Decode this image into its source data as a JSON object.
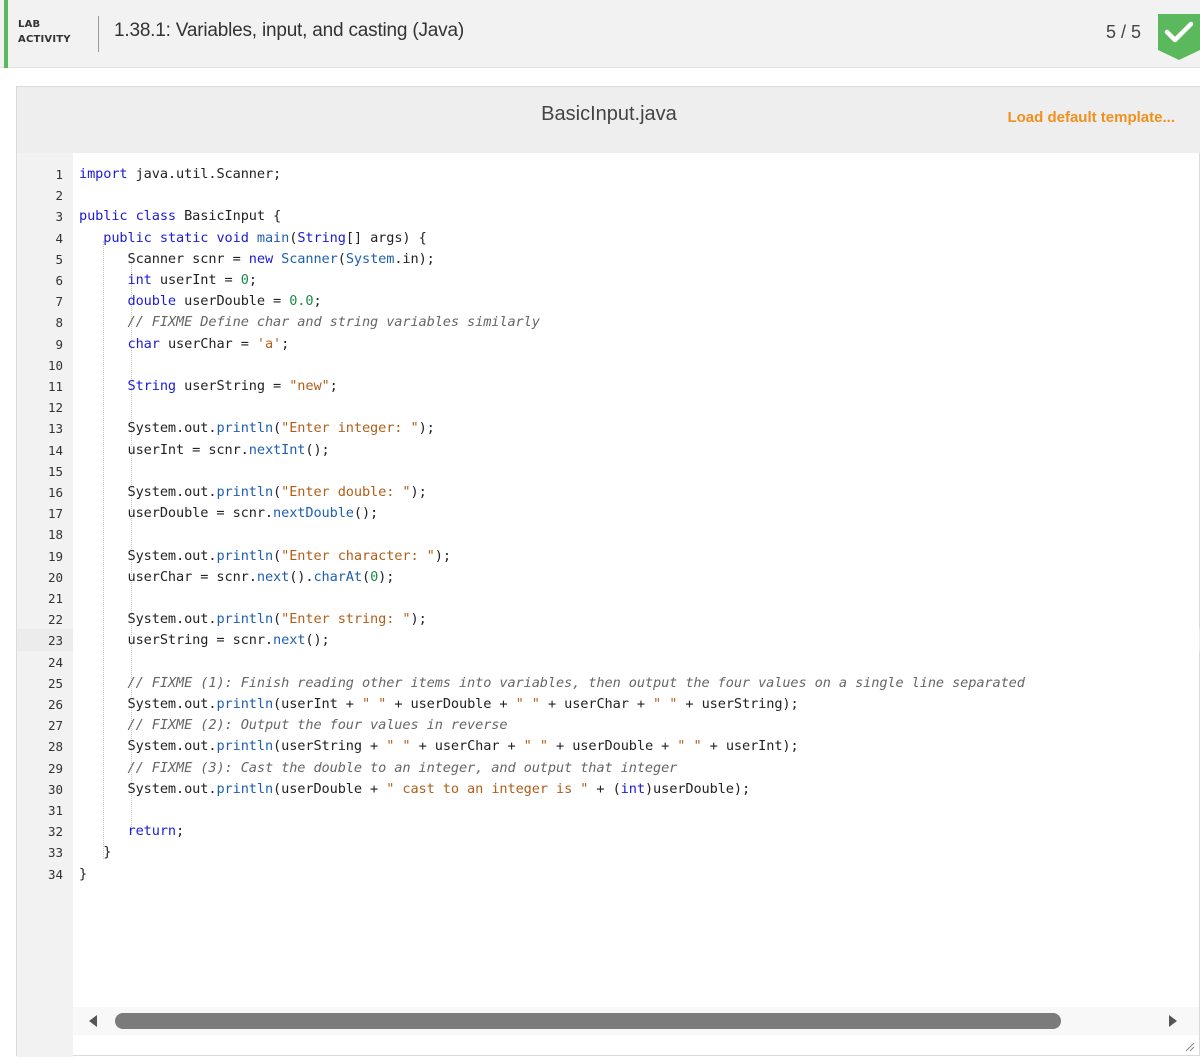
{
  "header": {
    "tag_line1": "LAB",
    "tag_line2": "ACTIVITY",
    "title": "1.38.1: Variables, input, and casting (Java)",
    "score": "5 / 5",
    "accent_color": "#5cb85c",
    "status_icon": "check-icon"
  },
  "editor": {
    "file_name": "BasicInput.java",
    "load_template_label": "Load default template...",
    "current_line": 23,
    "lines": [
      "1",
      "2",
      "3",
      "4",
      "5",
      "6",
      "7",
      "8",
      "9",
      "10",
      "11",
      "12",
      "13",
      "14",
      "15",
      "16",
      "17",
      "18",
      "19",
      "20",
      "21",
      "22",
      "23",
      "24",
      "25",
      "26",
      "27",
      "28",
      "29",
      "30",
      "31",
      "32",
      "33",
      "34"
    ],
    "code": [
      [
        {
          "t": "import",
          "c": "kw"
        },
        {
          "t": " java.util.Scanner;"
        }
      ],
      [],
      [
        {
          "t": "public class",
          "c": "kw"
        },
        {
          "t": " BasicInput {"
        }
      ],
      [
        {
          "t": "   "
        },
        {
          "t": "public static void",
          "c": "kw"
        },
        {
          "t": " "
        },
        {
          "t": "main",
          "c": "fn"
        },
        {
          "t": "("
        },
        {
          "t": "String",
          "c": "kw"
        },
        {
          "t": "[] args) {"
        }
      ],
      [
        {
          "t": "      Scanner scnr = "
        },
        {
          "t": "new",
          "c": "kw"
        },
        {
          "t": " "
        },
        {
          "t": "Scanner",
          "c": "fn"
        },
        {
          "t": "("
        },
        {
          "t": "System",
          "c": "fn"
        },
        {
          "t": ".in);"
        }
      ],
      [
        {
          "t": "      "
        },
        {
          "t": "int",
          "c": "kw"
        },
        {
          "t": " userInt = "
        },
        {
          "t": "0",
          "c": "num"
        },
        {
          "t": ";"
        }
      ],
      [
        {
          "t": "      "
        },
        {
          "t": "double",
          "c": "kw"
        },
        {
          "t": " userDouble = "
        },
        {
          "t": "0.0",
          "c": "num"
        },
        {
          "t": ";"
        }
      ],
      [
        {
          "t": "      "
        },
        {
          "t": "// FIXME Define char and string variables similarly",
          "c": "cmt"
        }
      ],
      [
        {
          "t": "      "
        },
        {
          "t": "char",
          "c": "kw"
        },
        {
          "t": " userChar = "
        },
        {
          "t": "'a'",
          "c": "str"
        },
        {
          "t": ";"
        }
      ],
      [],
      [
        {
          "t": "      "
        },
        {
          "t": "String",
          "c": "kw"
        },
        {
          "t": " userString = "
        },
        {
          "t": "\"new\"",
          "c": "str"
        },
        {
          "t": ";"
        }
      ],
      [],
      [
        {
          "t": "      System.out."
        },
        {
          "t": "println",
          "c": "fn"
        },
        {
          "t": "("
        },
        {
          "t": "\"Enter integer: \"",
          "c": "str"
        },
        {
          "t": ");"
        }
      ],
      [
        {
          "t": "      userInt = scnr."
        },
        {
          "t": "nextInt",
          "c": "fn"
        },
        {
          "t": "();"
        }
      ],
      [],
      [
        {
          "t": "      System.out."
        },
        {
          "t": "println",
          "c": "fn"
        },
        {
          "t": "("
        },
        {
          "t": "\"Enter double: \"",
          "c": "str"
        },
        {
          "t": ");"
        }
      ],
      [
        {
          "t": "      userDouble = scnr."
        },
        {
          "t": "nextDouble",
          "c": "fn"
        },
        {
          "t": "();"
        }
      ],
      [],
      [
        {
          "t": "      System.out."
        },
        {
          "t": "println",
          "c": "fn"
        },
        {
          "t": "("
        },
        {
          "t": "\"Enter character: \"",
          "c": "str"
        },
        {
          "t": ");"
        }
      ],
      [
        {
          "t": "      userChar = scnr."
        },
        {
          "t": "next",
          "c": "fn"
        },
        {
          "t": "()."
        },
        {
          "t": "charAt",
          "c": "fn"
        },
        {
          "t": "("
        },
        {
          "t": "0",
          "c": "num"
        },
        {
          "t": ");"
        }
      ],
      [],
      [
        {
          "t": "      System.out."
        },
        {
          "t": "println",
          "c": "fn"
        },
        {
          "t": "("
        },
        {
          "t": "\"Enter string: \"",
          "c": "str"
        },
        {
          "t": ");"
        }
      ],
      [
        {
          "t": "      userString = scnr."
        },
        {
          "t": "next",
          "c": "fn"
        },
        {
          "t": "();"
        }
      ],
      [],
      [
        {
          "t": "      "
        },
        {
          "t": "// FIXME (1): Finish reading other items into variables, then output the four values on a single line separated",
          "c": "cmt"
        }
      ],
      [
        {
          "t": "      System.out."
        },
        {
          "t": "println",
          "c": "fn"
        },
        {
          "t": "(userInt + "
        },
        {
          "t": "\" \"",
          "c": "str"
        },
        {
          "t": " + userDouble + "
        },
        {
          "t": "\" \"",
          "c": "str"
        },
        {
          "t": " + userChar + "
        },
        {
          "t": "\" \"",
          "c": "str"
        },
        {
          "t": " + userString);"
        }
      ],
      [
        {
          "t": "      "
        },
        {
          "t": "// FIXME (2): Output the four values in reverse",
          "c": "cmt"
        }
      ],
      [
        {
          "t": "      System.out."
        },
        {
          "t": "println",
          "c": "fn"
        },
        {
          "t": "(userString + "
        },
        {
          "t": "\" \"",
          "c": "str"
        },
        {
          "t": " + userChar + "
        },
        {
          "t": "\" \"",
          "c": "str"
        },
        {
          "t": " + userDouble + "
        },
        {
          "t": "\" \"",
          "c": "str"
        },
        {
          "t": " + userInt);"
        }
      ],
      [
        {
          "t": "      "
        },
        {
          "t": "// FIXME (3): Cast the double to an integer, and output that integer",
          "c": "cmt"
        }
      ],
      [
        {
          "t": "      System.out."
        },
        {
          "t": "println",
          "c": "fn"
        },
        {
          "t": "(userDouble + "
        },
        {
          "t": "\" cast to an integer is \"",
          "c": "str"
        },
        {
          "t": " + ("
        },
        {
          "t": "int",
          "c": "kw"
        },
        {
          "t": ")userDouble);"
        }
      ],
      [],
      [
        {
          "t": "      "
        },
        {
          "t": "return",
          "c": "kw"
        },
        {
          "t": ";"
        }
      ],
      [
        {
          "t": "   }"
        }
      ],
      [
        {
          "t": "}"
        }
      ]
    ],
    "scroll_left_icon": "triangle-left-icon",
    "scroll_right_icon": "triangle-right-icon"
  }
}
